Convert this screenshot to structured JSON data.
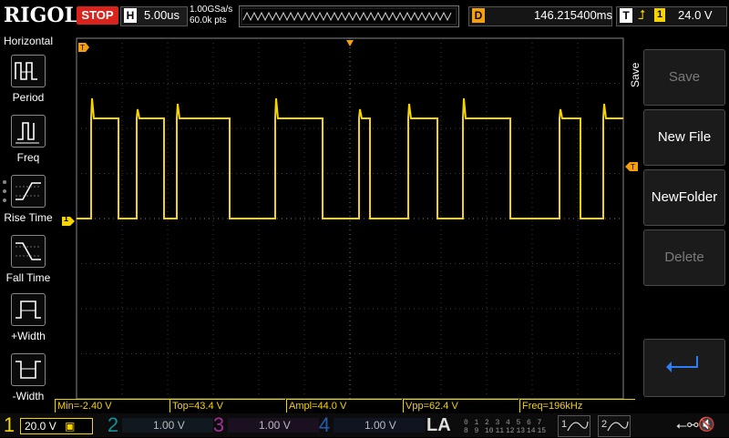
{
  "top": {
    "brand": "RIGOL",
    "run_state": "STOP",
    "horizontal_label": "H",
    "timebase": "5.00us",
    "sample_rate": "1.00GSa/s",
    "memory_depth": "60.0k pts",
    "delay_label": "D",
    "delay_value": "146.215400ms",
    "trigger_label": "T",
    "trigger_edge_icon": "rising-edge-icon",
    "trigger_channel": "1",
    "trigger_level": "24.0 V"
  },
  "left_menu": {
    "title": "Horizontal",
    "items": [
      {
        "label": "Period",
        "icon": "period-icon"
      },
      {
        "label": "Freq",
        "icon": "frequency-icon"
      },
      {
        "label": "Rise Time",
        "icon": "rise-time-icon"
      },
      {
        "label": "Fall Time",
        "icon": "fall-time-icon"
      },
      {
        "label": "+Width",
        "icon": "positive-width-icon"
      },
      {
        "label": "-Width",
        "icon": "negative-width-icon"
      }
    ]
  },
  "right_menu": {
    "title": "Save",
    "items": [
      {
        "label": "Save",
        "enabled": false
      },
      {
        "label": "New File",
        "enabled": true
      },
      {
        "label": "NewFolder",
        "enabled": true
      },
      {
        "label": "Delete",
        "enabled": false
      },
      {
        "label": "",
        "icon": "return-arrow-icon",
        "enabled": true
      }
    ]
  },
  "measurements": [
    {
      "label": "Min=-2.40 V"
    },
    {
      "label": "Top=43.4 V"
    },
    {
      "label": "Ampl=44.0 V"
    },
    {
      "label": "Vpp=62.4 V"
    },
    {
      "label": "Freq=196kHz"
    }
  ],
  "channels": [
    {
      "num": "1",
      "scale": "20.0 V",
      "active": true,
      "color": "#f5d400"
    },
    {
      "num": "2",
      "scale": "1.00 V",
      "active": false,
      "color": "#17c7d4"
    },
    {
      "num": "3",
      "scale": "1.00 V",
      "active": false,
      "color": "#e43fd8"
    },
    {
      "num": "4",
      "scale": "1.00 V",
      "active": false,
      "color": "#2f7df4"
    }
  ],
  "la": {
    "label": "LA",
    "digits_top": [
      "0",
      "1",
      "2",
      "3",
      "4",
      "5",
      "6",
      "7"
    ],
    "digits_bottom": [
      "8",
      "9",
      "10",
      "11",
      "12",
      "13",
      "14",
      "15"
    ]
  },
  "edge_buttons": [
    {
      "num": "1"
    },
    {
      "num": "2"
    }
  ],
  "markers": {
    "ch1_marker": "1"
  },
  "colors": {
    "ch1": "#f5d400",
    "trigger_marker": "#f5a00b",
    "stop": "#d8241c",
    "grid": "#5a5a5a"
  }
}
